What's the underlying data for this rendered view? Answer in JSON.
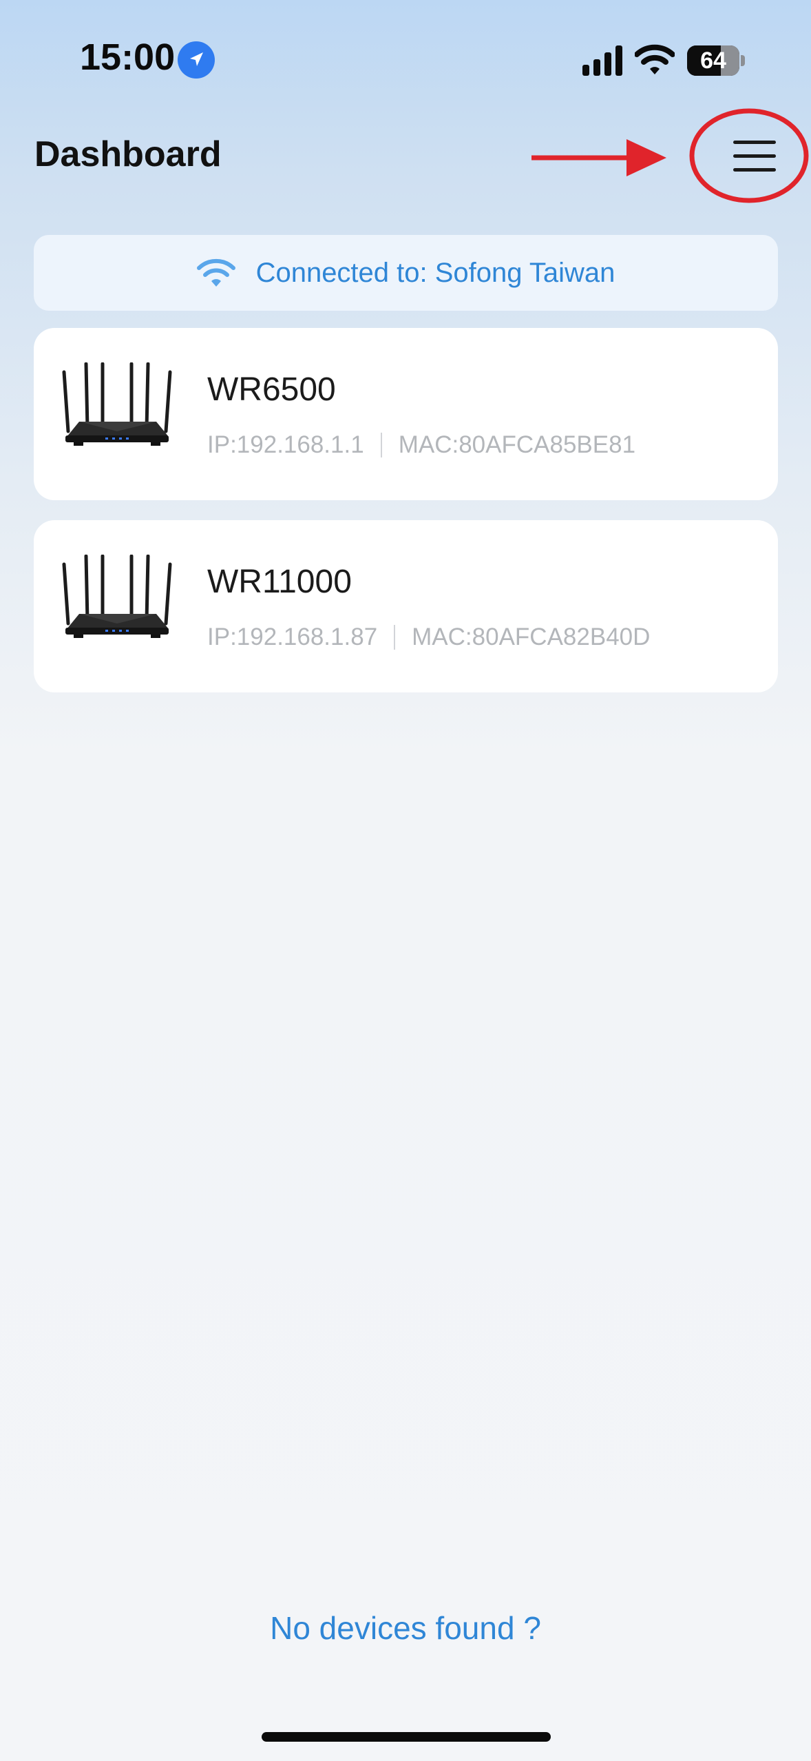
{
  "status_bar": {
    "time": "15:00",
    "battery_level": "64",
    "battery_fraction": 0.64,
    "location_icon": "location-arrow-icon",
    "signal_icon": "cellular-signal-icon",
    "wifi_icon": "wifi-icon"
  },
  "header": {
    "title": "Dashboard",
    "menu_icon": "hamburger-menu-icon",
    "annotation_color": "#e0242b"
  },
  "banner": {
    "text": "Connected to: Sofong Taiwan",
    "icon": "wifi-icon",
    "color": "#2f86d6"
  },
  "devices": [
    {
      "name": "WR6500",
      "ip": "IP:192.168.1.1",
      "mac": "MAC:80AFCA85BE81",
      "image": "router-image"
    },
    {
      "name": "WR11000",
      "ip": "IP:192.168.1.87",
      "mac": "MAC:80AFCA82B40D",
      "image": "router-image"
    }
  ],
  "footer": {
    "no_devices_link": "No devices found ?"
  }
}
